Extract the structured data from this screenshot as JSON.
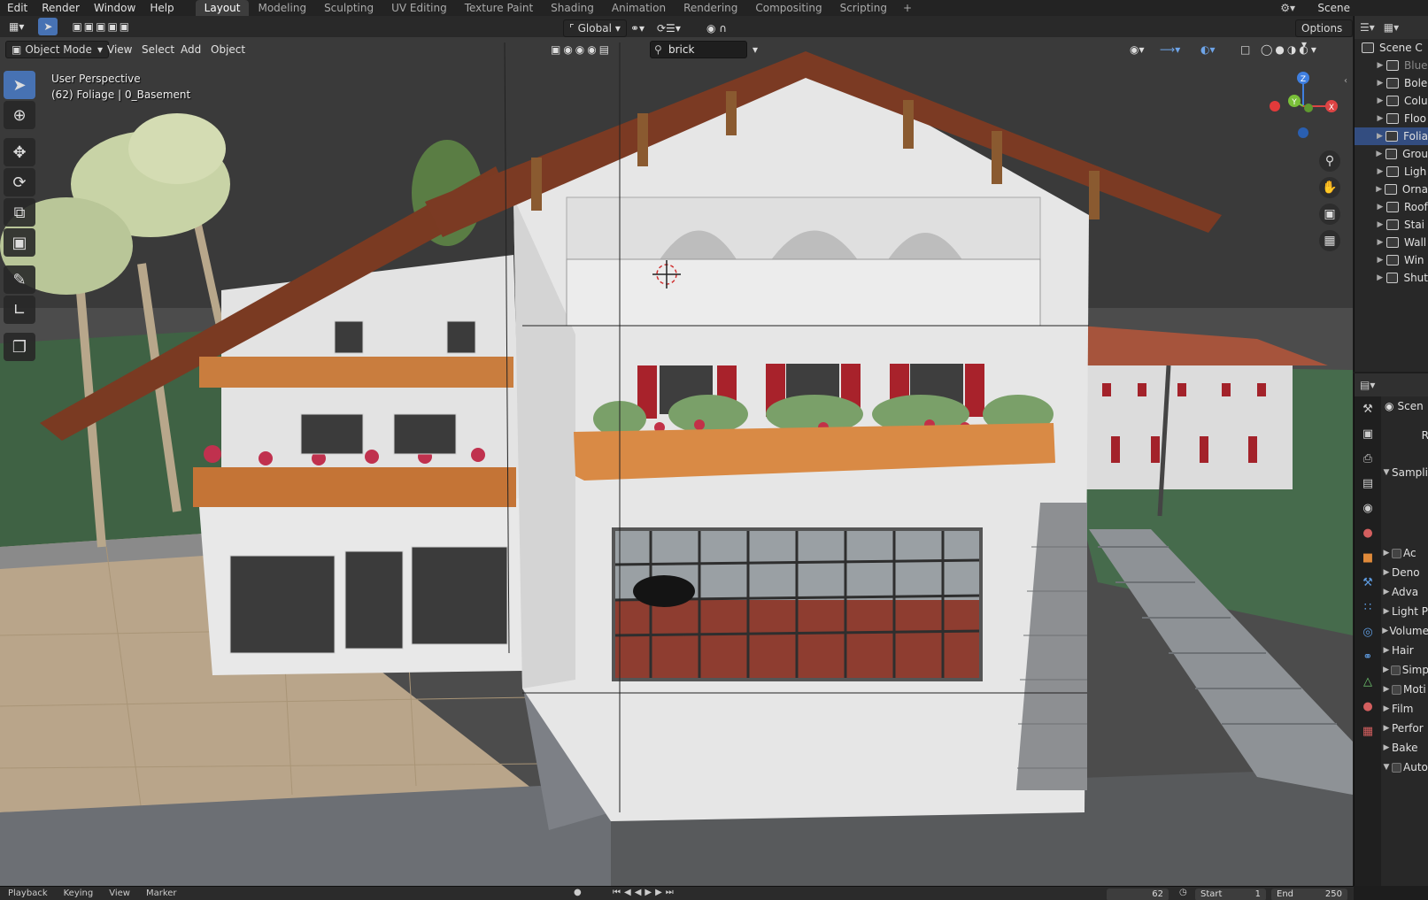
{
  "top_menu": {
    "items": [
      "Edit",
      "Render",
      "Window",
      "Help"
    ],
    "workspace_tabs": [
      "Layout",
      "Modeling",
      "Sculpting",
      "UV Editing",
      "Texture Paint",
      "Shading",
      "Animation",
      "Rendering",
      "Compositing",
      "Scripting"
    ],
    "active_tab": "Layout",
    "add_tab": "+",
    "scene_name": "Scene"
  },
  "viewport_header": {
    "orientation": "Global",
    "options_label": "Options",
    "mode": "Object Mode",
    "menus": [
      "View",
      "Select",
      "Add",
      "Object"
    ],
    "search_value": "brick"
  },
  "viewport_info": {
    "line1": "User Perspective",
    "line2": "(62) Foliage | 0_Basement"
  },
  "gizmo": {
    "z": "Z",
    "y": "Y",
    "x": "X"
  },
  "outliner": {
    "header": "Scene C",
    "items": [
      {
        "label": "Blue",
        "selected": false,
        "dim": true
      },
      {
        "label": "Bole",
        "selected": false
      },
      {
        "label": "Colu",
        "selected": false
      },
      {
        "label": "Floo",
        "selected": false
      },
      {
        "label": "Folia",
        "selected": true
      },
      {
        "label": "Grou",
        "selected": false
      },
      {
        "label": "Ligh",
        "selected": false
      },
      {
        "label": "Orna",
        "selected": false
      },
      {
        "label": "Roof",
        "selected": false
      },
      {
        "label": "Stai",
        "selected": false
      },
      {
        "label": "Wall",
        "selected": false
      },
      {
        "label": "Win",
        "selected": false
      },
      {
        "label": "Shut",
        "selected": false
      }
    ]
  },
  "properties": {
    "header": "Scen",
    "render_engine_short": "R",
    "section": "Sampli",
    "rows": [
      {
        "label": "Ac",
        "arrow": true,
        "checkbox": true
      },
      {
        "label": "Deno",
        "arrow": true,
        "checkbox": false
      },
      {
        "label": "Adva",
        "arrow": true,
        "checkbox": false
      },
      {
        "label": "Light P",
        "arrow": true,
        "checkbox": false
      },
      {
        "label": "Volume",
        "arrow": true,
        "checkbox": false
      },
      {
        "label": "Hair",
        "arrow": true,
        "checkbox": false
      },
      {
        "label": "Simp",
        "arrow": true,
        "checkbox": true
      },
      {
        "label": "Moti",
        "arrow": true,
        "checkbox": true
      },
      {
        "label": "Film",
        "arrow": true,
        "checkbox": false
      },
      {
        "label": "Perfor",
        "arrow": true,
        "checkbox": false
      },
      {
        "label": "Bake",
        "arrow": true,
        "checkbox": false
      },
      {
        "label": "Auto",
        "arrow": true,
        "checkbox": true,
        "expanded": true
      }
    ]
  },
  "timeline": {
    "menus": [
      "Playback",
      "Keying",
      "View",
      "Marker"
    ],
    "current_frame": "62",
    "start_label": "Start",
    "start_value": "1",
    "end_label": "End",
    "end_value": "250"
  },
  "colors": {
    "accent": "#4772b3",
    "selection": "#334d80",
    "roof": "#7a3a22",
    "wall": "#e6e6e6",
    "planter": "#c97d3e",
    "grass": "#3f6244"
  }
}
